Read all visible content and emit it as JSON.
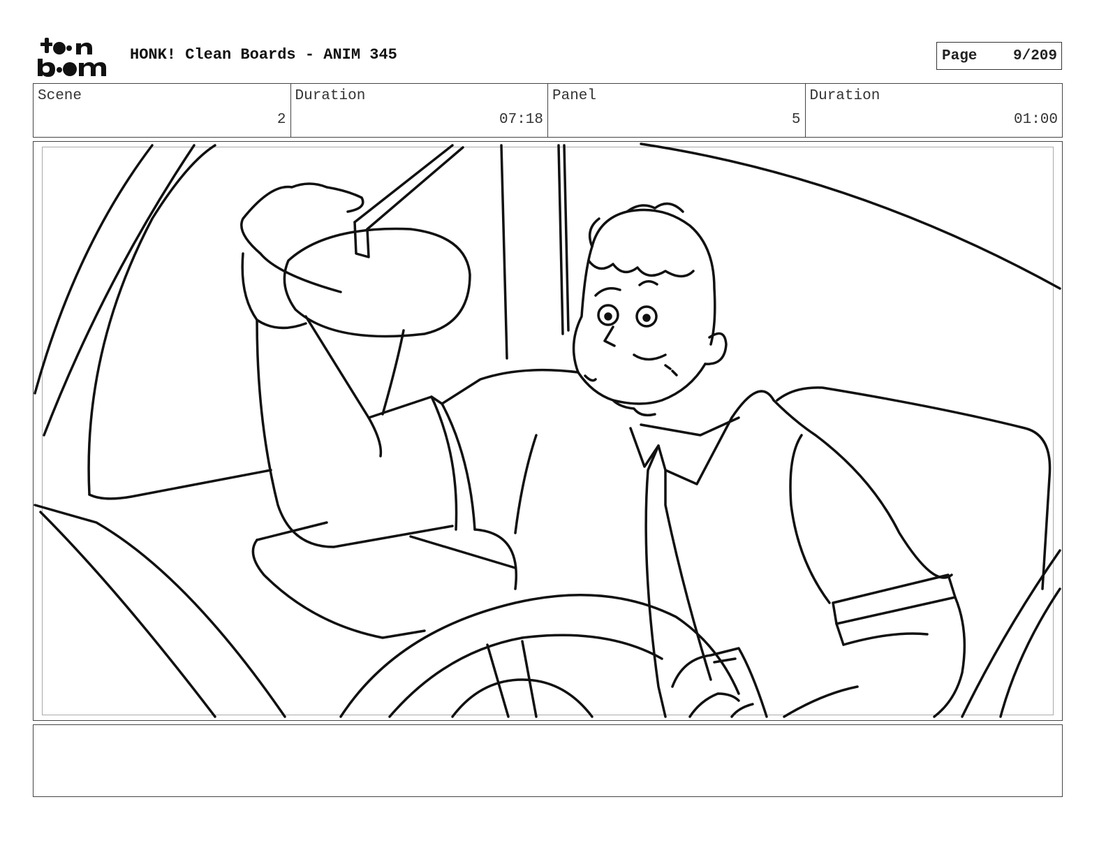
{
  "header": {
    "logo_text": "toon boom",
    "title": "HONK! Clean Boards - ANIM 345",
    "page_label": "Page",
    "page_value": "9/209"
  },
  "info": {
    "scene_label": "Scene",
    "scene_value": "2",
    "scene_duration_label": "Duration",
    "scene_duration_value": "07:18",
    "panel_label": "Panel",
    "panel_value": "5",
    "panel_duration_label": "Duration",
    "panel_duration_value": "01:00"
  },
  "notes": {
    "text": ""
  }
}
